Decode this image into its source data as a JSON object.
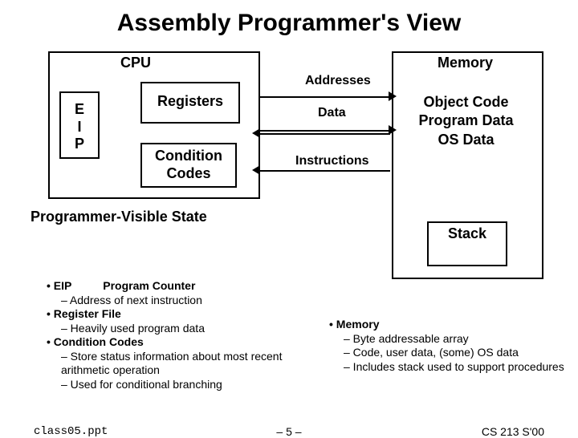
{
  "title": "Assembly Programmer's View",
  "cpu": {
    "label": "CPU",
    "eip": "E\nI\nP",
    "registers": "Registers",
    "condition": "Condition\nCodes"
  },
  "bus": {
    "addresses": "Addresses",
    "data": "Data",
    "instructions": "Instructions"
  },
  "memory": {
    "label": "Memory",
    "contents": "Object Code\nProgram Data\nOS Data",
    "stack": "Stack"
  },
  "pv_state_title": "Programmer-Visible State",
  "left_bullets": {
    "l1a": "• EIP",
    "l1b": "Program Counter",
    "l2": "– Address of next instruction",
    "l3": "• Register File",
    "l4": "– Heavily used program data",
    "l5": "• Condition Codes",
    "l6": "– Store status information about most recent arithmetic operation",
    "l7": "– Used for conditional branching"
  },
  "right_bullets": {
    "r1": "• Memory",
    "r2": "– Byte addressable array",
    "r3": "– Code, user data, (some) OS data",
    "r4": "– Includes stack used to support procedures"
  },
  "footer": {
    "left": "class05.ppt",
    "mid": "– 5 –",
    "right": "CS 213 S'00"
  }
}
